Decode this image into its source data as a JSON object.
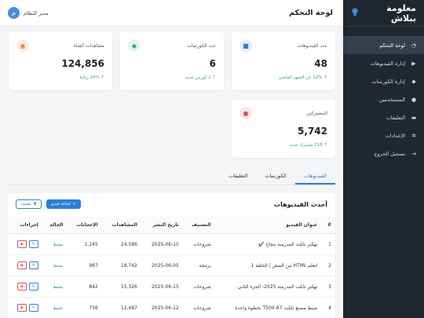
{
  "brand": {
    "name": "معلومة ببلاش"
  },
  "sidebar": {
    "items": [
      {
        "label": "لوحة التحكم",
        "icon": "gauge-icon",
        "active": true
      },
      {
        "label": "إدارة الفيديوهات",
        "icon": "video-icon",
        "active": false
      },
      {
        "label": "إدارة الكورسات",
        "icon": "graduation-cap-icon",
        "active": false
      },
      {
        "label": "المستخدمين",
        "icon": "users-icon",
        "active": false
      },
      {
        "label": "التعليقات",
        "icon": "comments-icon",
        "active": false
      },
      {
        "label": "الإعدادات",
        "icon": "gear-icon",
        "active": false
      },
      {
        "label": "تسجيل الخروج",
        "icon": "sign-out-icon",
        "active": false
      }
    ]
  },
  "header": {
    "title": "لوحة التحكم",
    "user_name": "مدير النظام",
    "avatar_letter": "م"
  },
  "stats": {
    "videos": {
      "label": "عدد الفيديوهات",
      "value": "48",
      "trend": "12% عن الشهر الماضي"
    },
    "courses": {
      "label": "عدد الكورسات",
      "value": "6",
      "trend": "2 كورس جديد"
    },
    "views": {
      "label": "مشاهدات القناة",
      "value": "124,856",
      "trend": "24% زيادة"
    },
    "subscribers": {
      "label": "المشتركين",
      "value": "5,742",
      "trend": "218 مشترك جديد"
    }
  },
  "colors": {
    "accent": "#2b7fd9",
    "videos_icon": "#2b7fd9",
    "courses_icon": "#2fa86a",
    "views_icon": "#e8742c",
    "subscribers_icon": "#d9534f",
    "positive": "#2fa86a"
  },
  "tabs": [
    {
      "label": "الفيديوهات",
      "active": true
    },
    {
      "label": "الكورسات",
      "active": false
    },
    {
      "label": "التعليقات",
      "active": false
    }
  ],
  "panel": {
    "title": "أحدث الفيديوهات",
    "add_button": "إضافة فيديو",
    "filter_button": "تصفية"
  },
  "table": {
    "headers": [
      "#",
      "عنوان الفيديو",
      "التصنيف",
      "تاريخ النشر",
      "المشاهدات",
      "الإعجابات",
      "الحالة",
      "إجراءات"
    ],
    "rows": [
      {
        "n": "1",
        "title": "تهكير تابلت المدرسة بنجاح ✔️",
        "category": "شروحات",
        "date": "2025-06-10",
        "views": "24,586",
        "likes": "1,245",
        "status": "نشط"
      },
      {
        "n": "2",
        "title": "اتعلم HTML من الصفر | الحلقة 1",
        "category": "برمجة",
        "date": "2025-06-05",
        "views": "18,742",
        "likes": "987",
        "status": "نشط"
      },
      {
        "n": "3",
        "title": "تهكير تابلت المدرسة 2025- الجزء الثاني",
        "category": "شروحات",
        "date": "2025-06-15",
        "views": "15,326",
        "likes": "842",
        "status": "نشط"
      },
      {
        "n": "4",
        "title": "ضبط مصنع تابلت T509 A7 بخطوة واحدة",
        "category": "شروحات",
        "date": "2025-06-12",
        "views": "12,487",
        "likes": "756",
        "status": "نشط"
      }
    ]
  }
}
